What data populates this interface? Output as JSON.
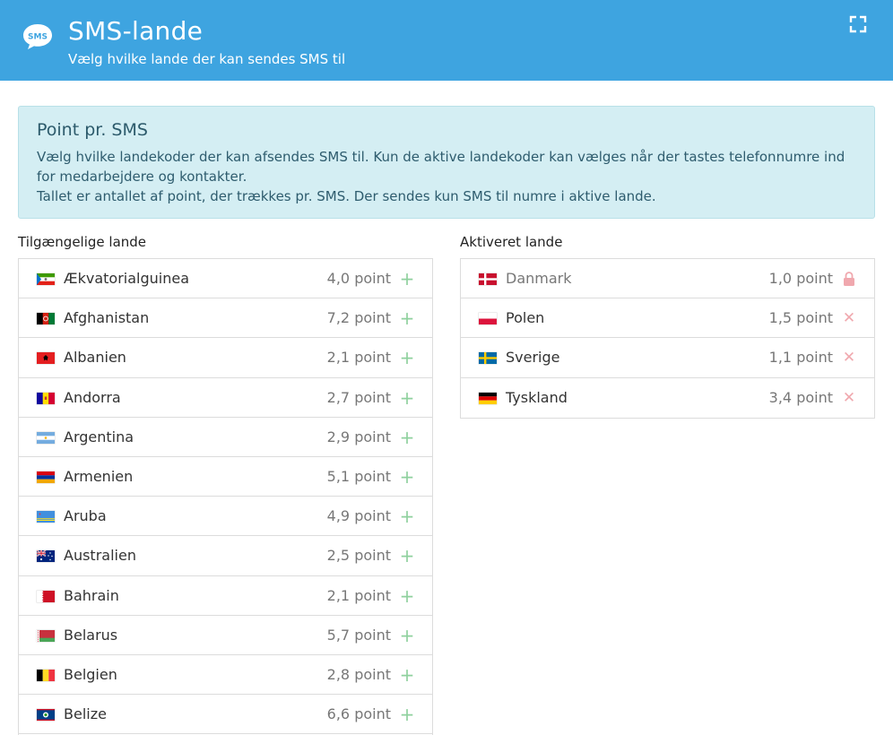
{
  "header": {
    "icon_text": "SMS",
    "title": "SMS-lande",
    "subtitle": "Vælg hvilke lande der kan sendes SMS til",
    "icons": {
      "app": "sms-bubble-icon",
      "expand": "expand-icon"
    }
  },
  "info": {
    "title": "Point pr. SMS",
    "line1": "Vælg hvilke landekoder der kan afsendes SMS til. Kun de aktive landekoder kan vælges når der tastes telefonnumre ind for medarbejdere og kontakter.",
    "line2": "Tallet er antallet af point, der trækkes pr. SMS. Der sendes kun SMS til numre i aktive lande."
  },
  "available": {
    "label": "Tilgængelige lande",
    "items": [
      {
        "name": "Ækvatorialguinea",
        "points": "4,0 point",
        "flag": "gq"
      },
      {
        "name": "Afghanistan",
        "points": "7,2 point",
        "flag": "af"
      },
      {
        "name": "Albanien",
        "points": "2,1 point",
        "flag": "al"
      },
      {
        "name": "Andorra",
        "points": "2,7 point",
        "flag": "ad"
      },
      {
        "name": "Argentina",
        "points": "2,9 point",
        "flag": "ar"
      },
      {
        "name": "Armenien",
        "points": "5,1 point",
        "flag": "am"
      },
      {
        "name": "Aruba",
        "points": "4,9 point",
        "flag": "aw"
      },
      {
        "name": "Australien",
        "points": "2,5 point",
        "flag": "au"
      },
      {
        "name": "Bahrain",
        "points": "2,1 point",
        "flag": "bh"
      },
      {
        "name": "Belarus",
        "points": "5,7 point",
        "flag": "by"
      },
      {
        "name": "Belgien",
        "points": "2,8 point",
        "flag": "be"
      },
      {
        "name": "Belize",
        "points": "6,6 point",
        "flag": "bz"
      }
    ],
    "action_glyph": "+"
  },
  "active": {
    "label": "Aktiveret lande",
    "items": [
      {
        "name": "Danmark",
        "points": "1,0 point",
        "flag": "dk",
        "locked": true
      },
      {
        "name": "Polen",
        "points": "1,5 point",
        "flag": "pl",
        "locked": false
      },
      {
        "name": "Sverige",
        "points": "1,1 point",
        "flag": "se",
        "locked": false
      },
      {
        "name": "Tyskland",
        "points": "3,4 point",
        "flag": "de",
        "locked": false
      }
    ],
    "remove_glyph": "✕"
  },
  "colors": {
    "header": "#3ea4e0",
    "info_bg": "#d4eef3",
    "add": "#8fd19e",
    "remove": "#f0a8ae"
  }
}
